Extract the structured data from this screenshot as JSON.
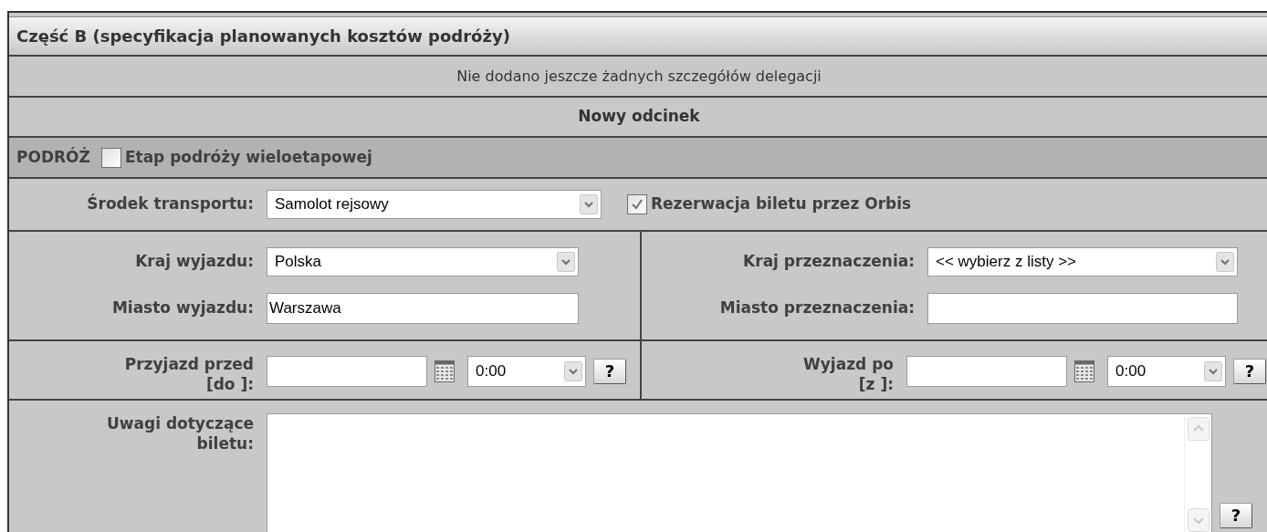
{
  "section": {
    "title": "Część B (specyfikacja planowanych kosztów podróży)"
  },
  "info_message": "Nie dodano jeszcze żadnych szczegółów delegacji",
  "subsection": {
    "title": "Nowy odcinek"
  },
  "travel": {
    "label": "PODRÓŻ",
    "multi_stage": {
      "label": "Etap podróży wieloetapowej",
      "checked": false
    }
  },
  "transport": {
    "label": "Środek transportu:",
    "value": "Samolot rejsowy",
    "booking": {
      "label": "Rezerwacja biletu przez Orbis",
      "checked": true
    }
  },
  "departure": {
    "country": {
      "label": "Kraj wyjazdu:",
      "value": "Polska"
    },
    "city": {
      "label": "Miasto wyjazdu:",
      "value": "Warszawa"
    },
    "date": {
      "label_lines": [
        "Przyjazd przed",
        "[do ]:"
      ],
      "time": "0:00",
      "help": "?"
    }
  },
  "destination": {
    "country": {
      "label": "Kraj przeznaczenia:",
      "value": "<< wybierz z listy >>"
    },
    "city": {
      "label": "Miasto przeznaczenia:"
    },
    "date": {
      "label_lines": [
        "Wyjazd po",
        "[z ]:"
      ],
      "time": "0:00",
      "help": "?"
    }
  },
  "notes": {
    "label_lines": [
      "Uwagi dotyczące",
      "biletu:"
    ],
    "help": "?"
  }
}
